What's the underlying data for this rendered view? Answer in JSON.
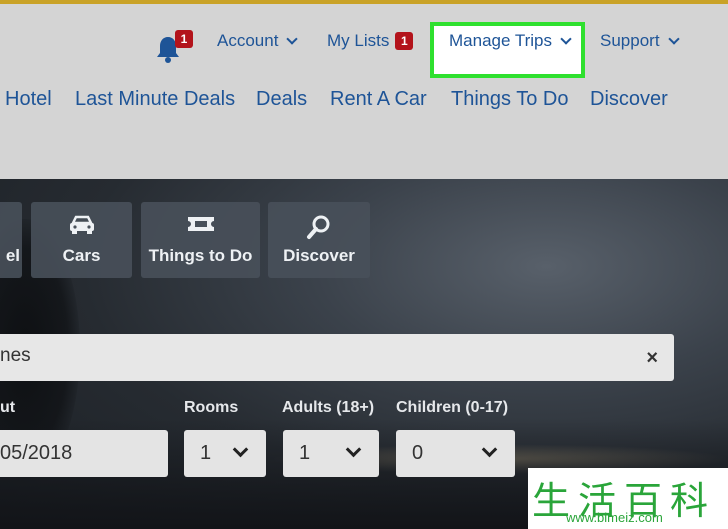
{
  "colors": {
    "accent_stripe": "#c9a227",
    "link_blue": "#1e5497",
    "badge_red": "#b3131b",
    "highlight_green": "#2ee02e",
    "watermark_green": "#2aa53a"
  },
  "util_nav": {
    "bell_icon": "bell-icon",
    "bell_badge": "1",
    "account": "Account",
    "my_lists": "My Lists",
    "my_lists_badge": "1",
    "manage_trips": "Manage Trips",
    "support": "Support"
  },
  "main_nav": [
    "Hotel",
    "Last Minute Deals",
    "Deals",
    "Rent A Car",
    "Things To Do",
    "Discover"
  ],
  "tiles": [
    {
      "label": "el",
      "icon": "bed-icon"
    },
    {
      "label": "Cars",
      "icon": "car-icon"
    },
    {
      "label": "Things to Do",
      "icon": "ticket-icon"
    },
    {
      "label": "Discover",
      "icon": "search-icon"
    }
  ],
  "search": {
    "value": "nes",
    "clear_icon": "×"
  },
  "fields": {
    "checkout_label": "ut",
    "checkout_value": "05/2018",
    "rooms_label": "Rooms",
    "rooms_value": "1",
    "adults_label": "Adults (18+)",
    "adults_value": "1",
    "children_label": "Children (0-17)",
    "children_value": "0"
  },
  "watermark": {
    "chars": "生活百科",
    "url": "www.bimeiz.com"
  }
}
